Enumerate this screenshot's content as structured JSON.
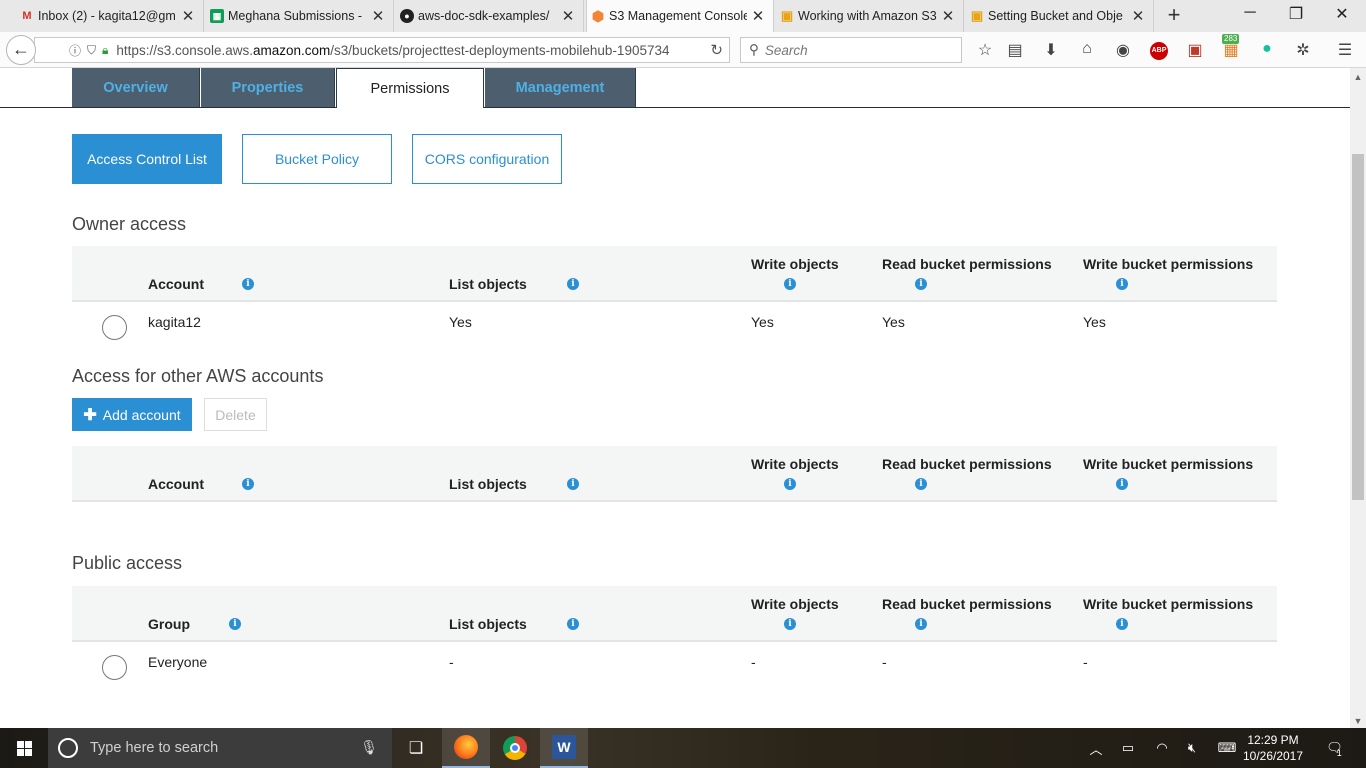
{
  "browser": {
    "tabs": [
      {
        "title": "Inbox (2) - kagita12@gm",
        "icon": "gmail-icon",
        "active": false
      },
      {
        "title": "Meghana Submissions -",
        "icon": "sheets-icon",
        "active": false
      },
      {
        "title": "aws-doc-sdk-examples/",
        "icon": "github-icon",
        "active": false
      },
      {
        "title": "S3 Management Console",
        "icon": "aws-icon",
        "active": true
      },
      {
        "title": "Working with Amazon S3",
        "icon": "aws-docs-icon",
        "active": false
      },
      {
        "title": "Setting Bucket and Obje",
        "icon": "aws-docs-icon",
        "active": false
      }
    ],
    "url_prefix": "https://s3.console.aws.",
    "url_domain": "amazon.com",
    "url_path": "/s3/buckets/projecttest-deployments-mobilehub-1905734",
    "search_placeholder": "Search",
    "extension_badge": "283",
    "abp_label": "ABP"
  },
  "page": {
    "main_tabs": [
      "Overview",
      "Properties",
      "Permissions",
      "Management"
    ],
    "active_main_tab": "Permissions",
    "sub_tabs": [
      "Access Control List",
      "Bucket Policy",
      "CORS configuration"
    ],
    "active_sub_tab": "Access Control List",
    "owner_section": {
      "title": "Owner access",
      "headers": {
        "account": "Account",
        "list": "List objects",
        "write": "Write objects",
        "read_bucket": "Read bucket permissions",
        "write_bucket": "Write bucket permissions"
      },
      "row": {
        "account": "kagita12",
        "list": "Yes",
        "write": "Yes",
        "read_bucket": "Yes",
        "write_bucket": "Yes"
      }
    },
    "other_section": {
      "title": "Access for other AWS accounts",
      "add_button": "Add account",
      "delete_button": "Delete",
      "headers": {
        "account": "Account",
        "list": "List objects",
        "write": "Write objects",
        "read_bucket": "Read bucket permissions",
        "write_bucket": "Write bucket permissions"
      }
    },
    "public_section": {
      "title": "Public access",
      "headers": {
        "group": "Group",
        "list": "List objects",
        "write": "Write objects",
        "read_bucket": "Read bucket permissions",
        "write_bucket": "Write bucket permissions"
      },
      "row": {
        "group": "Everyone",
        "list": "-",
        "write": "-",
        "read_bucket": "-",
        "write_bucket": "-"
      }
    }
  },
  "taskbar": {
    "search_placeholder": "Type here to search",
    "time": "12:29 PM",
    "date": "10/26/2017",
    "notification_count": "1"
  },
  "colors": {
    "accent": "#2b8fd3",
    "tab_dark": "#4d5e6f",
    "tab_text": "#4fb0e6"
  }
}
